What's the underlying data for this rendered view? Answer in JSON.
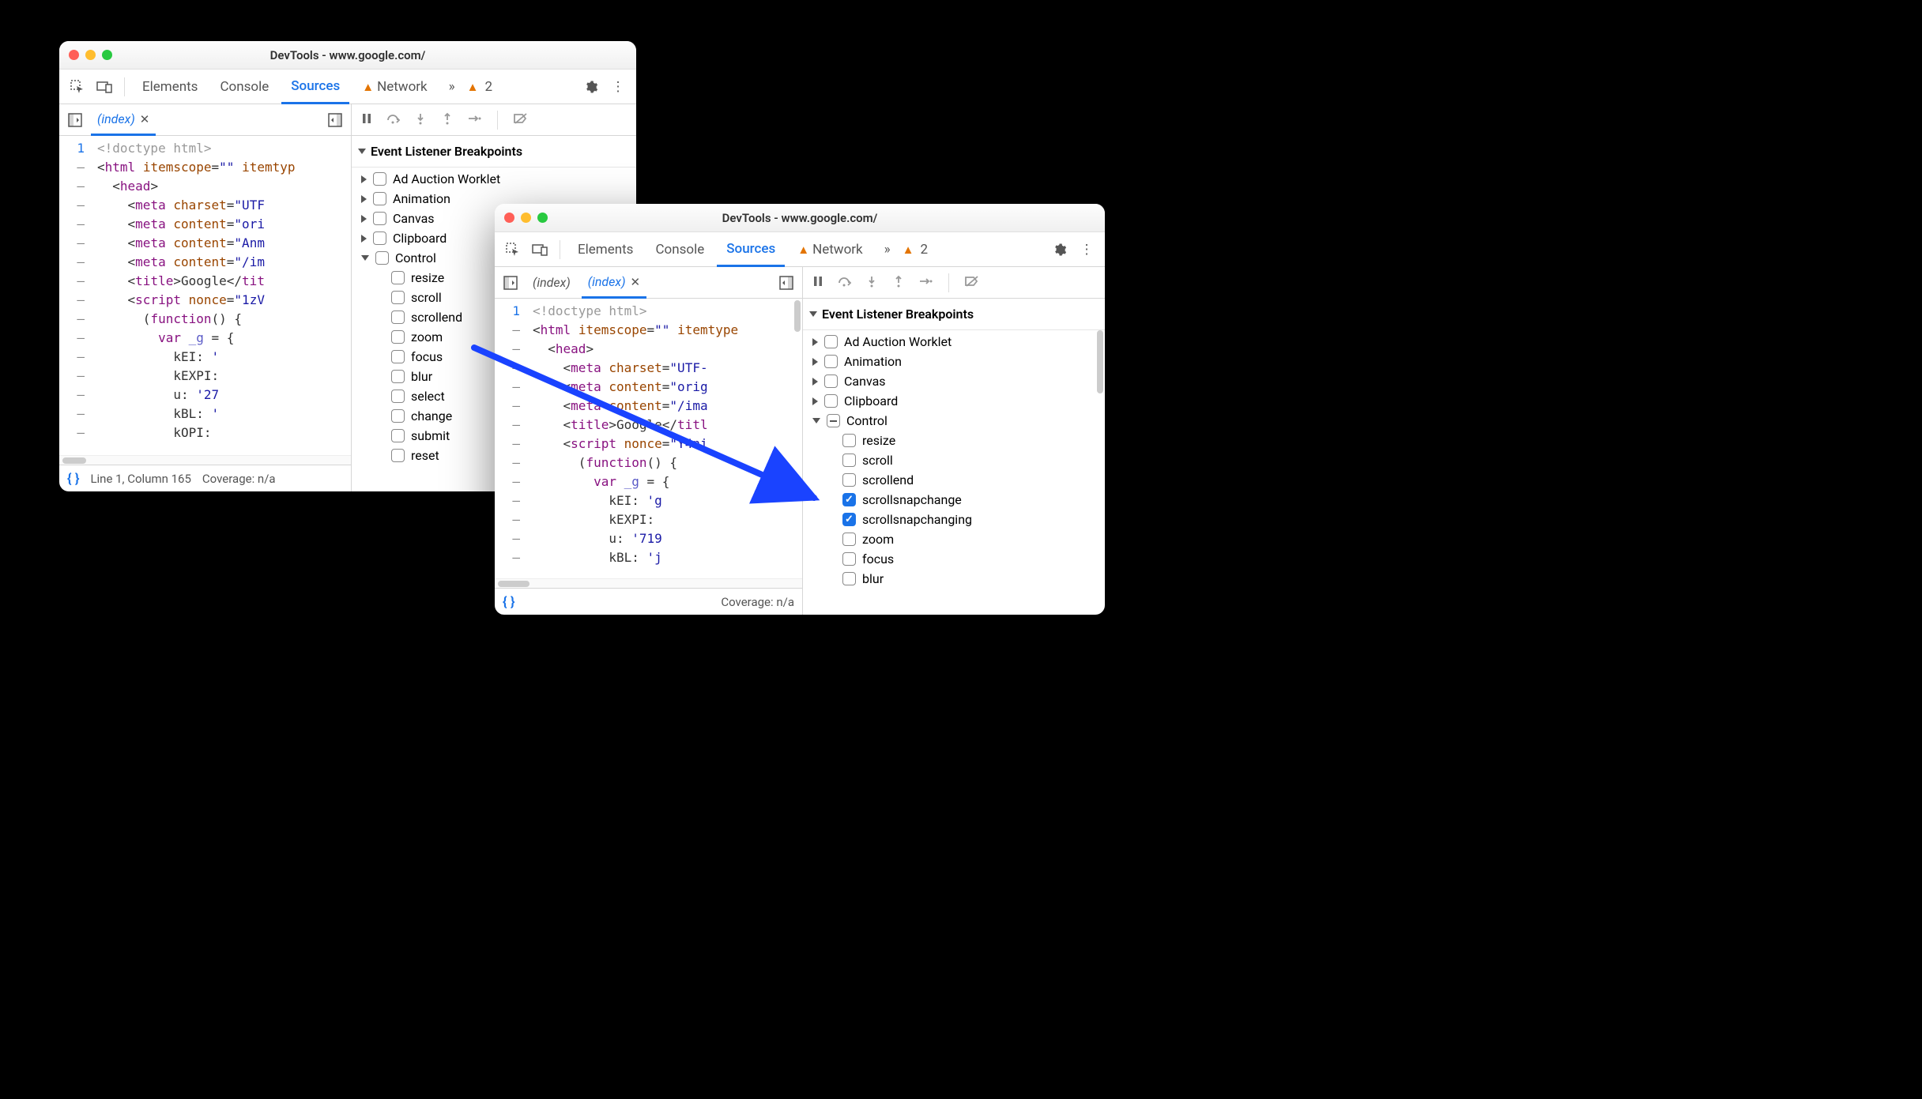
{
  "windows": {
    "a": {
      "title": "DevTools - www.google.com/",
      "toolbar": {
        "tabs": [
          "Elements",
          "Console",
          "Sources",
          "Network"
        ],
        "active": "Sources",
        "warn_count": "2"
      },
      "file_tabs": [
        {
          "label": "(index)",
          "active": true
        }
      ],
      "cursor_status": "Line 1, Column 165",
      "coverage_status": "Coverage: n/a",
      "gutter": [
        "1",
        "—",
        "—",
        "—",
        "—",
        "—",
        "—",
        "—",
        "—",
        "—",
        "—",
        "—",
        "—",
        "—",
        "—",
        "—"
      ],
      "code_lines": [
        {
          "html": "<span class='c-doctype'>&lt;!doctype html&gt;</span>"
        },
        {
          "html": "&lt;<span class='c-tag'>html</span> <span class='c-attr'>itemscope</span>=<span class='c-str'>\"\"</span> <span class='c-attr'>itemtyp</span>"
        },
        {
          "html": "  &lt;<span class='c-tag'>head</span>&gt;"
        },
        {
          "html": "    &lt;<span class='c-tag'>meta</span> <span class='c-attr'>charset</span>=<span class='c-str'>\"UTF</span>"
        },
        {
          "html": "    &lt;<span class='c-tag'>meta</span> <span class='c-attr'>content</span>=<span class='c-str'>\"ori</span>"
        },
        {
          "html": "    &lt;<span class='c-tag'>meta</span> <span class='c-attr'>content</span>=<span class='c-str'>\"Anm</span>"
        },
        {
          "html": "    &lt;<span class='c-tag'>meta</span> <span class='c-attr'>content</span>=<span class='c-str'>\"/im</span>"
        },
        {
          "html": "    &lt;<span class='c-tag'>title</span>&gt;Google&lt;/<span class='c-tag'>tit</span>"
        },
        {
          "html": "    &lt;<span class='c-tag'>script</span> <span class='c-attr'>nonce</span>=<span class='c-str'>\"1zV</span>"
        },
        {
          "html": "      (<span class='c-kw'>function</span>() {"
        },
        {
          "html": "        <span class='c-kw'>var</span> <span class='c-var'>_g</span> = {"
        },
        {
          "html": "          kEI: <span class='c-str'>'</span>"
        },
        {
          "html": "          kEXPI:"
        },
        {
          "html": "          u: <span class='c-str'>'27</span>"
        },
        {
          "html": "          kBL: <span class='c-str'>'</span>"
        },
        {
          "html": "          kOPI:"
        }
      ],
      "bp_header": "Event Listener Breakpoints",
      "categories": [
        {
          "name": "Ad Auction Worklet",
          "expanded": false
        },
        {
          "name": "Animation",
          "expanded": false
        },
        {
          "name": "Canvas",
          "expanded": false
        },
        {
          "name": "Clipboard",
          "expanded": false
        },
        {
          "name": "Control",
          "expanded": true,
          "items": [
            {
              "name": "resize",
              "checked": false
            },
            {
              "name": "scroll",
              "checked": false
            },
            {
              "name": "scrollend",
              "checked": false
            },
            {
              "name": "zoom",
              "checked": false
            },
            {
              "name": "focus",
              "checked": false
            },
            {
              "name": "blur",
              "checked": false
            },
            {
              "name": "select",
              "checked": false
            },
            {
              "name": "change",
              "checked": false
            },
            {
              "name": "submit",
              "checked": false
            },
            {
              "name": "reset",
              "checked": false
            }
          ]
        }
      ]
    },
    "b": {
      "title": "DevTools - www.google.com/",
      "toolbar": {
        "tabs": [
          "Elements",
          "Console",
          "Sources",
          "Network"
        ],
        "active": "Sources",
        "warn_count": "2"
      },
      "file_tabs": [
        {
          "label": "(index)",
          "active": false
        },
        {
          "label": "(index)",
          "active": true
        }
      ],
      "coverage_status": "Coverage: n/a",
      "gutter": [
        "1",
        "—",
        "—",
        "—",
        "—",
        "—",
        "—",
        "—",
        "—",
        "—",
        "—",
        "—",
        "—",
        "—"
      ],
      "code_lines": [
        {
          "html": "<span class='c-doctype'>&lt;!doctype html&gt;</span>"
        },
        {
          "html": "&lt;<span class='c-tag'>html</span> <span class='c-attr'>itemscope</span>=<span class='c-str'>\"\"</span> <span class='c-attr'>itemtype</span>"
        },
        {
          "html": "  &lt;<span class='c-tag'>head</span>&gt;"
        },
        {
          "html": "    &lt;<span class='c-tag'>meta</span> <span class='c-attr'>charset</span>=<span class='c-str'>\"UTF-</span>"
        },
        {
          "html": "    &lt;<span class='c-tag'>meta</span> <span class='c-attr'>content</span>=<span class='c-str'>\"orig</span>"
        },
        {
          "html": "    &lt;<span class='c-tag'>meta</span> <span class='c-attr'>content</span>=<span class='c-str'>\"/ima</span>"
        },
        {
          "html": "    &lt;<span class='c-tag'>title</span>&gt;Google&lt;/<span class='c-tag'>titl</span>"
        },
        {
          "html": "    &lt;<span class='c-tag'>script</span> <span class='c-attr'>nonce</span>=<span class='c-str'>\"Y4ni</span>"
        },
        {
          "html": "      (<span class='c-kw'>function</span>() {"
        },
        {
          "html": "        <span class='c-kw'>var</span> <span class='c-var'>_g</span> = {"
        },
        {
          "html": "          kEI: <span class='c-str'>'g</span>"
        },
        {
          "html": "          kEXPI:"
        },
        {
          "html": "          u: <span class='c-str'>'719</span>"
        },
        {
          "html": "          kBL: <span class='c-str'>'j</span>"
        }
      ],
      "bp_header": "Event Listener Breakpoints",
      "categories": [
        {
          "name": "Ad Auction Worklet",
          "expanded": false
        },
        {
          "name": "Animation",
          "expanded": false
        },
        {
          "name": "Canvas",
          "expanded": false
        },
        {
          "name": "Clipboard",
          "expanded": false
        },
        {
          "name": "Control",
          "expanded": true,
          "mixed": true,
          "items": [
            {
              "name": "resize",
              "checked": false
            },
            {
              "name": "scroll",
              "checked": false
            },
            {
              "name": "scrollend",
              "checked": false
            },
            {
              "name": "scrollsnapchange",
              "checked": true
            },
            {
              "name": "scrollsnapchanging",
              "checked": true
            },
            {
              "name": "zoom",
              "checked": false
            },
            {
              "name": "focus",
              "checked": false
            },
            {
              "name": "blur",
              "checked": false
            }
          ]
        }
      ]
    }
  }
}
